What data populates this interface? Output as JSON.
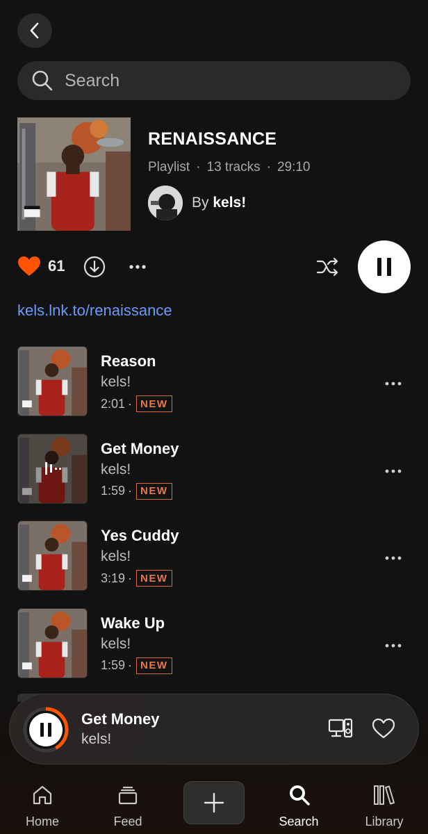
{
  "search": {
    "placeholder": "Search"
  },
  "playlist": {
    "title": "RENAISSANCE",
    "kind": "Playlist",
    "track_count": "13 tracks",
    "duration": "29:10",
    "author_prefix": "By",
    "author": "kels!",
    "likes": "61",
    "link": "kels.lnk.to/renaissance"
  },
  "tracks": [
    {
      "title": "Reason",
      "artist": "kels!",
      "duration": "2:01",
      "badge": "NEW",
      "playing": false
    },
    {
      "title": "Get Money",
      "artist": "kels!",
      "duration": "1:59",
      "badge": "NEW",
      "playing": true
    },
    {
      "title": "Yes Cuddy",
      "artist": "kels!",
      "duration": "3:19",
      "badge": "NEW",
      "playing": false
    },
    {
      "title": "Wake Up",
      "artist": "kels!",
      "duration": "1:59",
      "badge": "NEW",
      "playing": false
    }
  ],
  "separator": "·",
  "now_playing": {
    "title": "Get Money",
    "artist": "kels!",
    "progress": 0.42
  },
  "tabs": [
    {
      "label": "Home",
      "icon": "home-icon",
      "active": false
    },
    {
      "label": "Feed",
      "icon": "feed-icon",
      "active": false
    },
    {
      "label": "",
      "icon": "plus-icon",
      "active": false
    },
    {
      "label": "Search",
      "icon": "search-icon",
      "active": true
    },
    {
      "label": "Library",
      "icon": "library-icon",
      "active": false
    }
  ],
  "colors": {
    "background": "#121212",
    "accent": "#ff5500",
    "link": "#6a9cf7",
    "badge": "#d86a3f"
  }
}
